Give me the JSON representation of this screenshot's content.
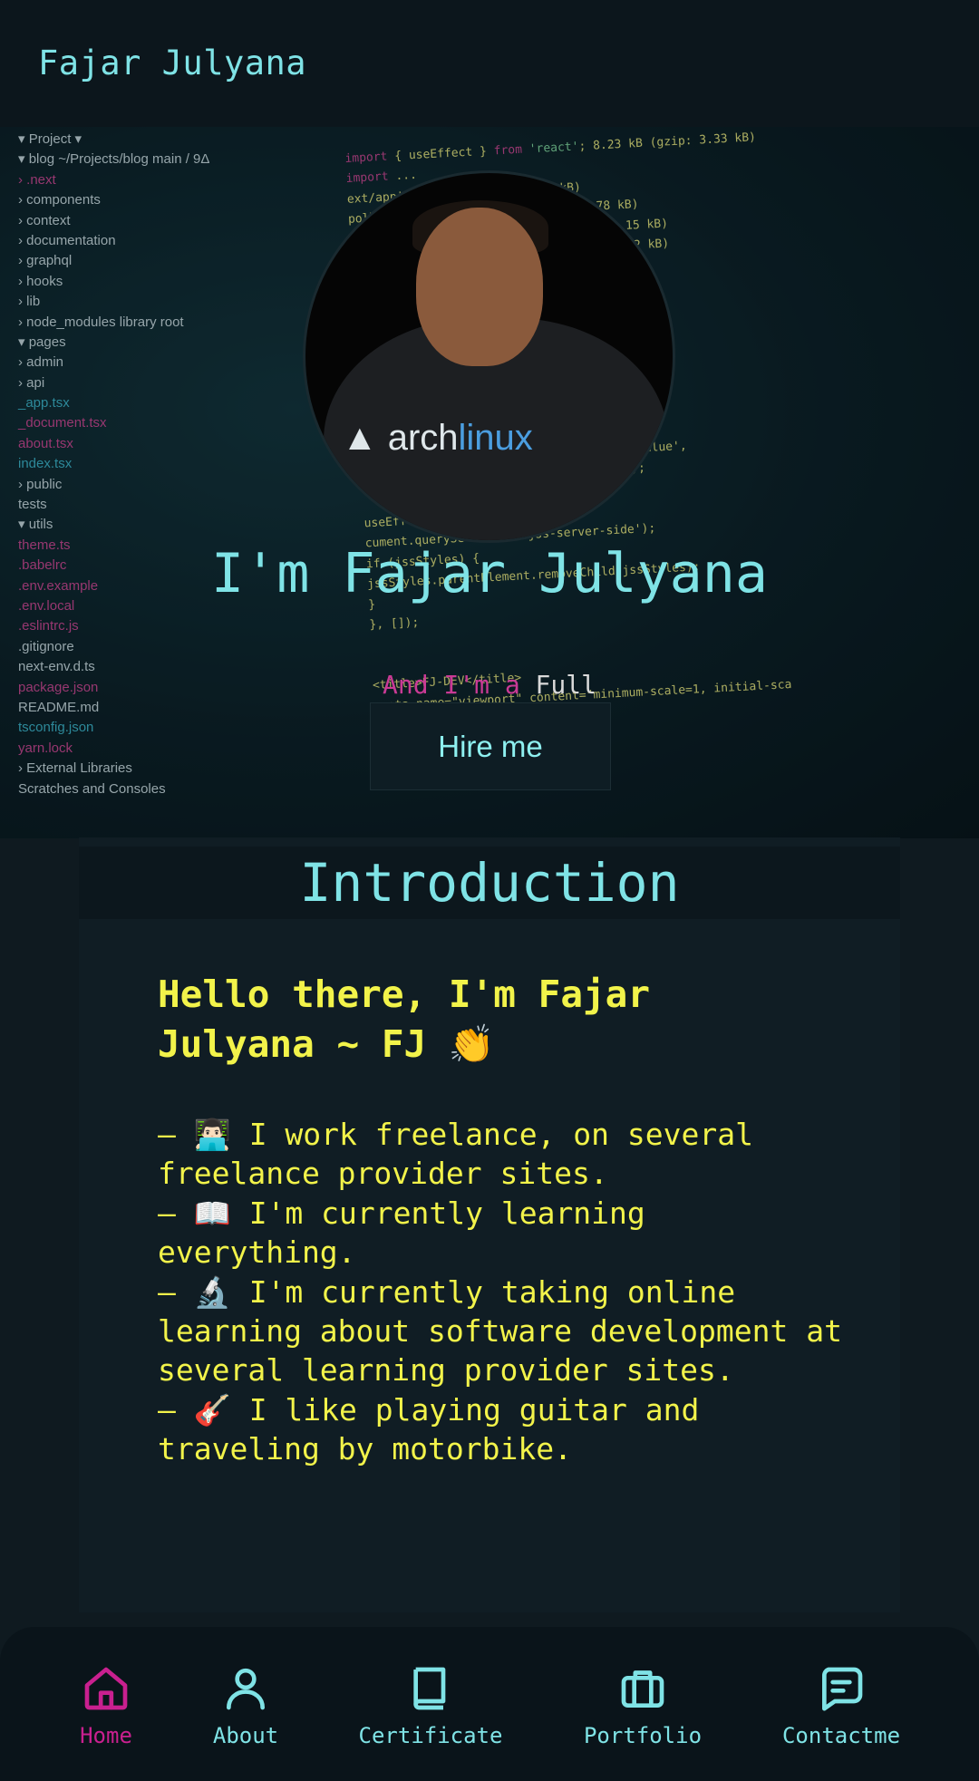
{
  "header": {
    "brand": "Fajar Julyana"
  },
  "hero": {
    "title": "I'm Fajar Julyana",
    "subtitle_part1": "And I'm a",
    "subtitle_part2": " Full",
    "hire_button": "Hire me"
  },
  "intro": {
    "heading": "Introduction",
    "greeting": "Hello there, I'm Fajar Julyana ~ FJ 👏",
    "items": [
      "– 👨🏻‍💻 I work freelance, on several freelance provider sites.",
      "– 📖 I'm currently learning everything.",
      "– 🔬 I'm currently taking online learning about software development at several learning provider sites.",
      "– 🎸 I like playing guitar and traveling by motorbike."
    ]
  },
  "nav": {
    "items": [
      {
        "label": "Home",
        "icon": "home-icon",
        "active": true
      },
      {
        "label": "About",
        "icon": "person-icon",
        "active": false
      },
      {
        "label": "Certificate",
        "icon": "book-icon",
        "active": false
      },
      {
        "label": "Portfolio",
        "icon": "briefcase-icon",
        "active": false
      },
      {
        "label": "Contactme",
        "icon": "message-icon",
        "active": false
      }
    ]
  },
  "colors": {
    "accent": "#7fe3e6",
    "active": "#c9208f",
    "text_yellow": "#f2f34a"
  }
}
